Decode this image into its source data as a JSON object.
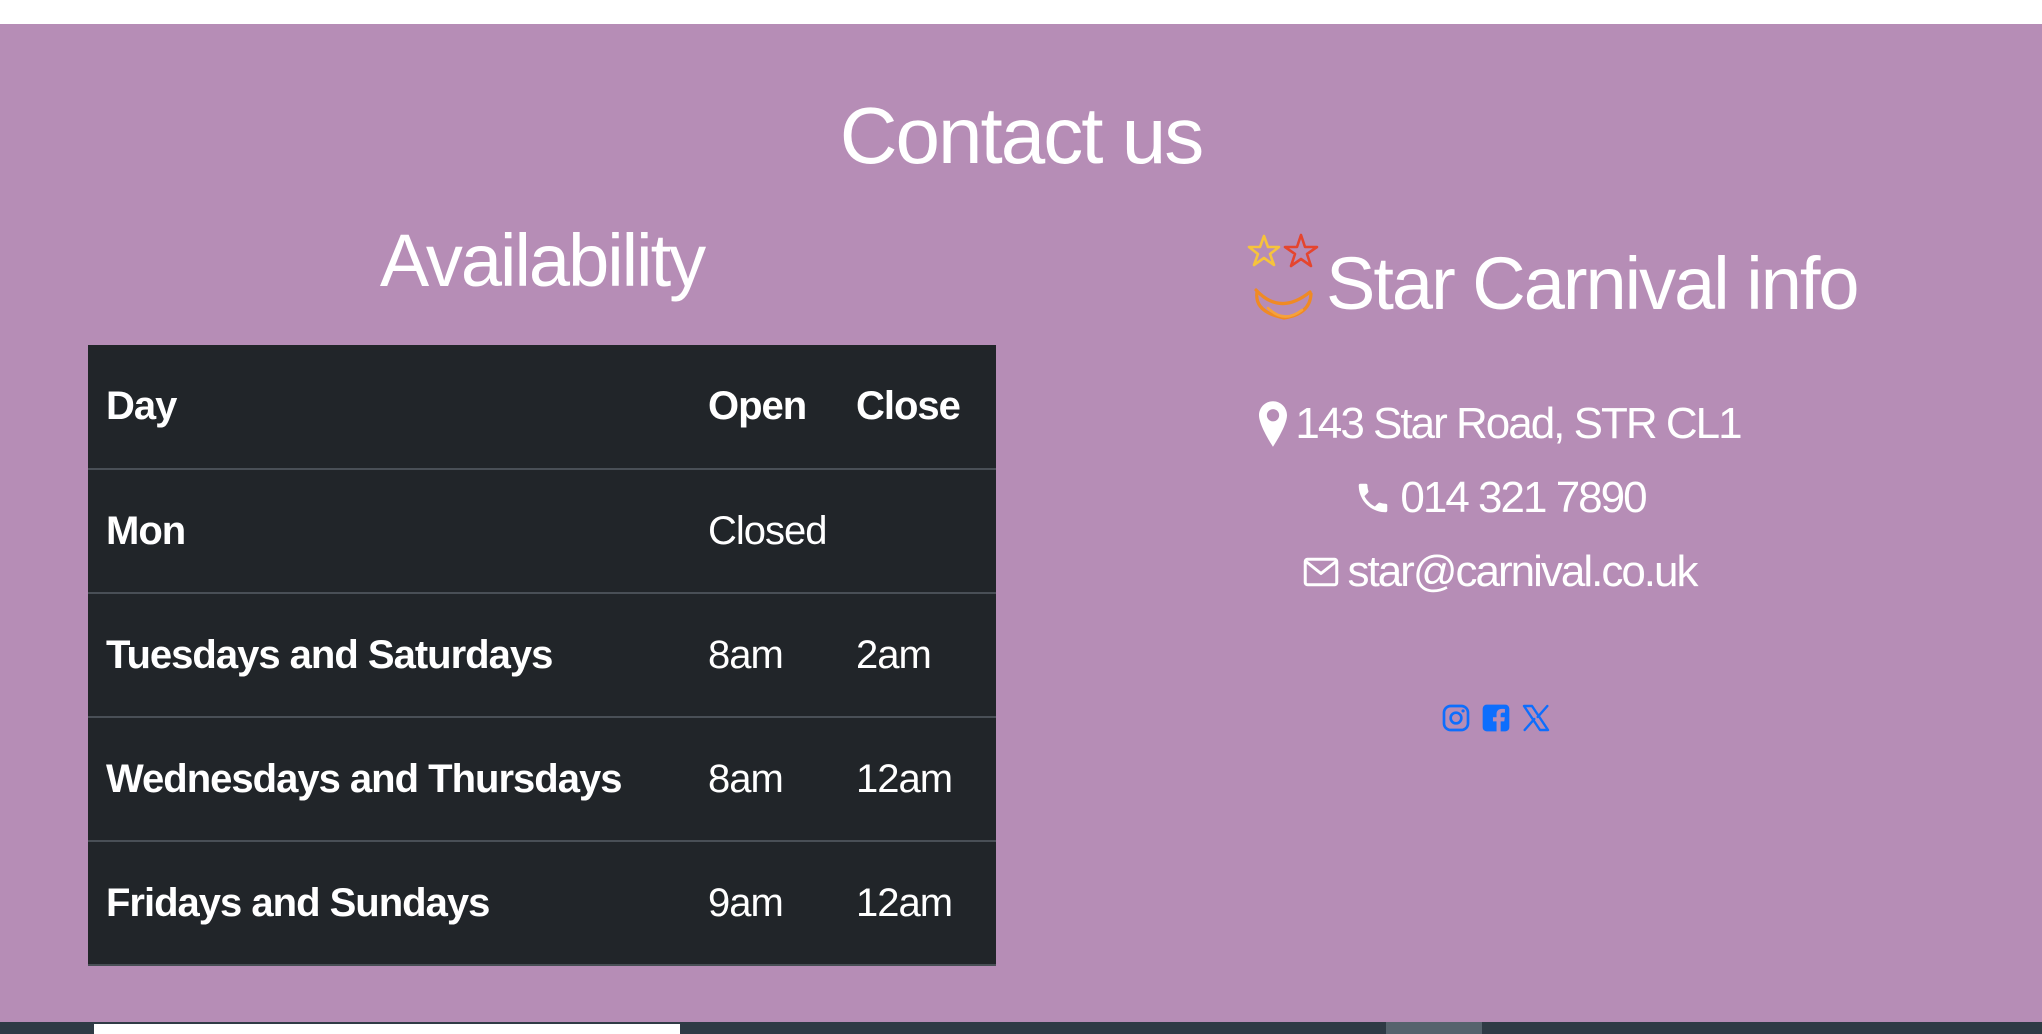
{
  "contact": {
    "title": "Contact us"
  },
  "availability": {
    "title": "Availability",
    "headers": [
      "Day",
      "Open",
      "Close"
    ],
    "rows": [
      {
        "day": "Mon",
        "open": "Closed",
        "close": ""
      },
      {
        "day": "Tuesdays and Saturdays",
        "open": "8am",
        "close": "2am"
      },
      {
        "day": "Wednesdays and Thursdays",
        "open": "8am",
        "close": "12am"
      },
      {
        "day": "Fridays and Sundays",
        "open": "9am",
        "close": "12am"
      }
    ]
  },
  "info": {
    "title": "Star Carnival info",
    "logo_icon": "star-carnival-logo",
    "address": "143 Star Road, STR CL1",
    "address_icon": "map-pin-icon",
    "phone": "014 321 7890",
    "phone_icon": "phone-icon",
    "email": "star@carnival.co.uk",
    "email_icon": "envelope-icon"
  },
  "social": [
    {
      "name": "instagram",
      "icon": "instagram-icon"
    },
    {
      "name": "facebook",
      "icon": "facebook-icon"
    },
    {
      "name": "x",
      "icon": "x-icon"
    }
  ],
  "colors": {
    "section_background": "#b68db6",
    "table_background": "#212529",
    "text": "#ffffff",
    "social_link": "#0d6efd",
    "logo_orange": "#f08a24",
    "logo_yellow": "#f6c33b",
    "logo_red": "#e5452e"
  }
}
